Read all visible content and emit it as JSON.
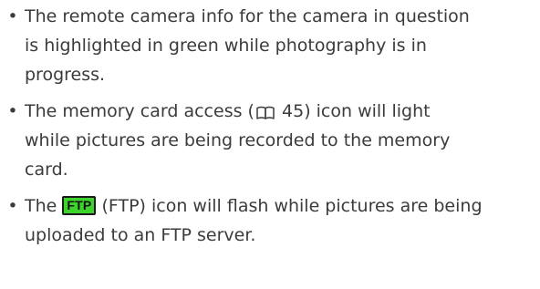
{
  "bullets": [
    {
      "lines": [
        "The remote camera info for the camera in question",
        "is highlighted in green while photography is in",
        "progress."
      ]
    },
    {
      "line1_before": "The memory card access (",
      "line1_page": "45",
      "line1_after": ") icon will light",
      "lines_rest": [
        "while pictures are being recorded to the memory",
        "card."
      ],
      "ref_icon": "book-icon"
    },
    {
      "line1_before": "The ",
      "badge": "FTP",
      "line1_after": " (FTP) icon will flash while pictures are being",
      "lines_rest": [
        "uploaded to an FTP server."
      ],
      "badge_color": "#3ed32c"
    }
  ],
  "bullet_glyph": "•",
  "text_color": "#3b3b3b"
}
